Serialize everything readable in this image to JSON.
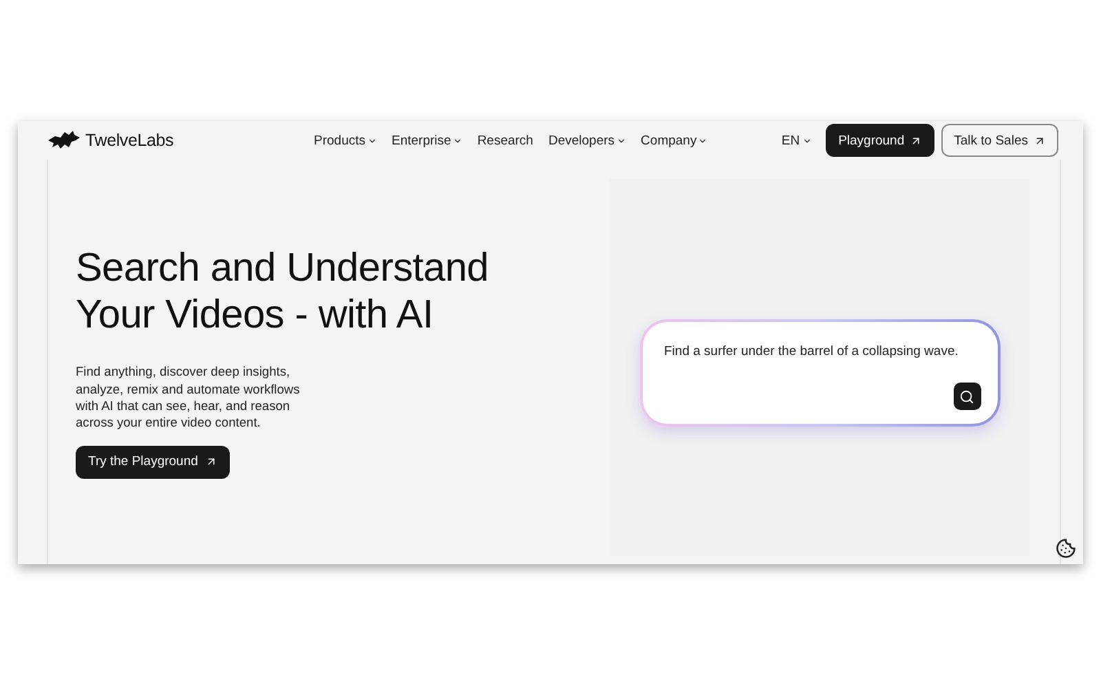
{
  "header": {
    "brand": "TwelveLabs",
    "nav": [
      {
        "label": "Products",
        "has_menu": true
      },
      {
        "label": "Enterprise",
        "has_menu": true
      },
      {
        "label": "Research",
        "has_menu": false
      },
      {
        "label": "Developers",
        "has_menu": true
      },
      {
        "label": "Company",
        "has_menu": true
      }
    ],
    "language": "EN",
    "actions": [
      {
        "label": "Playground",
        "kind": "primary"
      },
      {
        "label": "Talk to Sales",
        "kind": "outline"
      }
    ]
  },
  "hero": {
    "title_lines": [
      "Search and Understand",
      "Your Videos - with AI"
    ],
    "description": "Find anything, discover deep insights, analyze, remix and automate workflows with AI that can see, hear, and reason across your entire video content.",
    "cta": "Try the Playground",
    "search": {
      "value": "Find a surfer under the barrel of a collapsing wave."
    }
  }
}
